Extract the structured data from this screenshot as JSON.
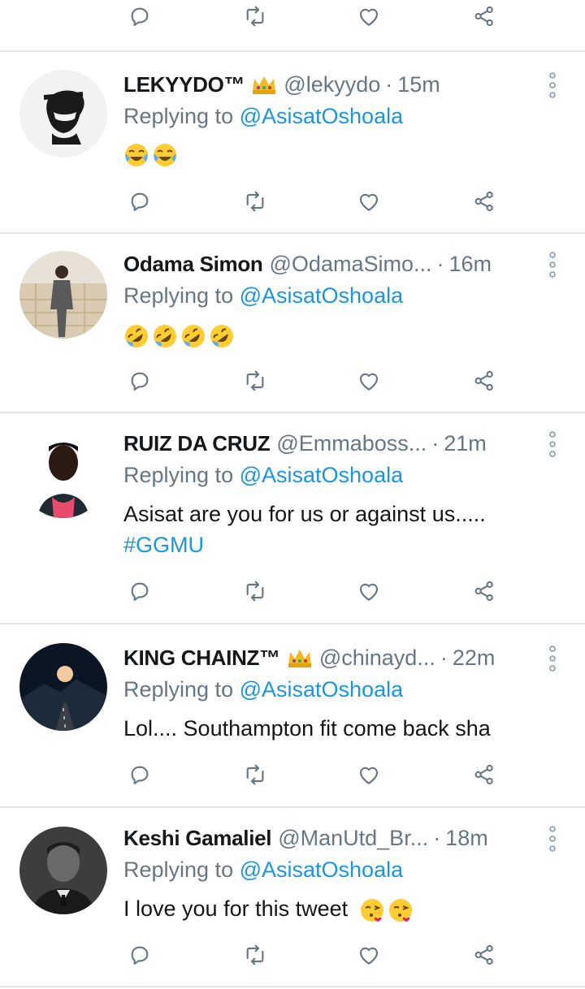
{
  "reply_prefix": "Replying to",
  "tweets": [
    {
      "name": "LEKYYDO™",
      "handle": "@lekyydo",
      "time": "15m",
      "mention": "@AsisatOshoala",
      "text": "",
      "emoji": [
        "face-with-tears-of-joy",
        "face-with-tears-of-joy"
      ]
    },
    {
      "name": "Odama Simon",
      "handle": "@OdamaSimo...",
      "time": "16m",
      "mention": "@AsisatOshoala",
      "text": "",
      "emoji": [
        "rolling-on-floor-laughing",
        "rolling-on-floor-laughing",
        "rolling-on-floor-laughing",
        "rolling-on-floor-laughing"
      ]
    },
    {
      "name": "RUIZ DA CRUZ",
      "handle": "@Emmaboss...",
      "time": "21m",
      "mention": "@AsisatOshoala",
      "text": "Asisat are you for us or against us.....",
      "hashtag": "#GGMU"
    },
    {
      "name": "KING CHAINZ™",
      "handle": "@chinayd...",
      "time": "22m",
      "mention": "@AsisatOshoala",
      "text": "Lol.... Southampton fit come back sha"
    },
    {
      "name": "Keshi Gamaliel",
      "handle": "@ManUtd_Br...",
      "time": "18m",
      "mention": "@AsisatOshoala",
      "text": "I love you for this tweet",
      "emoji": [
        "face-blowing-a-kiss",
        "face-blowing-a-kiss"
      ]
    }
  ],
  "colors": {
    "text": "#14171a",
    "secondary": "#657786",
    "link": "#1b95e0",
    "divider": "#e1e6ea"
  },
  "icons": {
    "reply": "reply-icon",
    "retweet": "retweet-icon",
    "like": "heart-icon",
    "share": "share-icon",
    "more": "more-icon",
    "crown": "crown-icon"
  }
}
